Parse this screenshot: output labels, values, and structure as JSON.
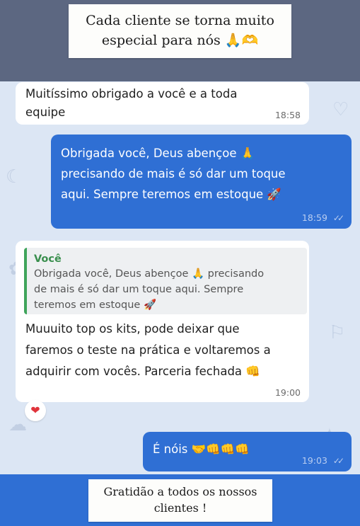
{
  "captions": {
    "top": "Cada cliente se torna muito\nespecial para nós 🙏🫶",
    "bottom": "Gratidão a todos os nossos\nclientes !"
  },
  "messages": [
    {
      "direction": "in",
      "text": "Muitíssimo obrigado a você e a toda\nequipe",
      "time": "18:58"
    },
    {
      "direction": "out",
      "text": "Obrigada você, Deus abençoe 🙏\nprecisando de mais é só dar um toque\naqui. Sempre teremos em estoque 🚀",
      "time": "18:59",
      "ticks": "✓✓"
    },
    {
      "direction": "in",
      "quote": {
        "author": "Você",
        "text": "Obrigada você, Deus abençoe 🙏 precisando\nde mais é só dar um toque aqui. Sempre\nteremos em estoque 🚀"
      },
      "text": "Muuuito top os kits, pode deixar que\nfaremos o teste na prática e voltaremos a\nadquirir com vocês. Parceria fechada 👊",
      "time": "19:00",
      "reaction": "❤"
    },
    {
      "direction": "out",
      "text": "É nóis 🤝👊👊👊",
      "time": "19:03",
      "ticks": "✓✓"
    }
  ],
  "colors": {
    "incoming": "#ffffff",
    "outgoing": "#2f6fd4",
    "quote_bar": "#3fa45b",
    "chat_background": "#dce6f4"
  }
}
